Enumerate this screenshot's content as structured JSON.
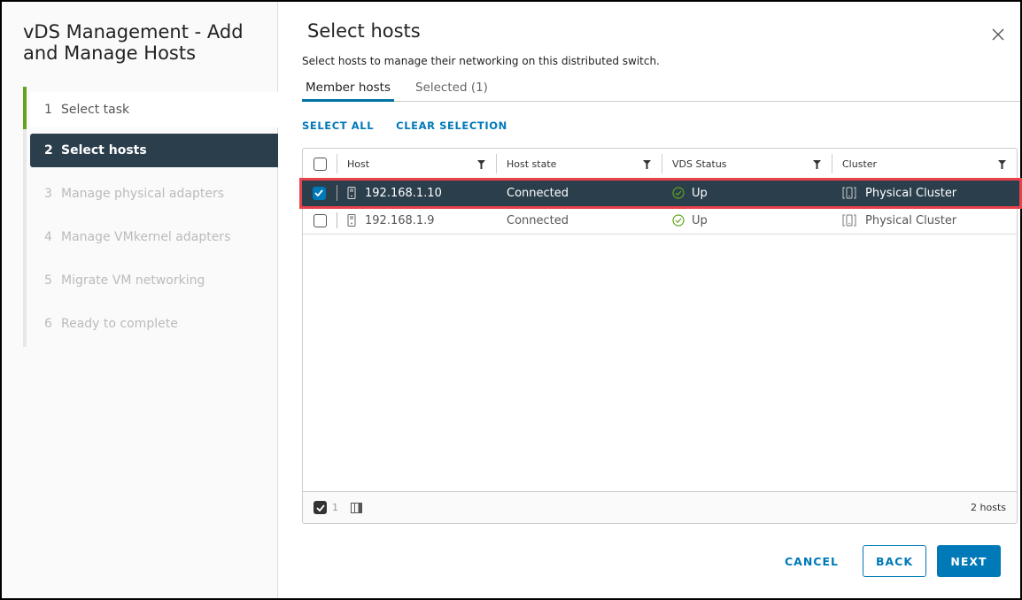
{
  "wizard": {
    "title": "vDS Management - Add and Manage Hosts",
    "steps": [
      {
        "num": "1",
        "label": "Select task",
        "state": "completed"
      },
      {
        "num": "2",
        "label": "Select hosts",
        "state": "active"
      },
      {
        "num": "3",
        "label": "Manage physical adapters",
        "state": "disabled"
      },
      {
        "num": "4",
        "label": "Manage VMkernel adapters",
        "state": "disabled"
      },
      {
        "num": "5",
        "label": "Migrate VM networking",
        "state": "disabled"
      },
      {
        "num": "6",
        "label": "Ready to complete",
        "state": "disabled"
      }
    ]
  },
  "page": {
    "title": "Select hosts",
    "subtitle": "Select hosts to manage their networking on this distributed switch.",
    "close_icon": "close-icon"
  },
  "tabs": [
    {
      "label": "Member hosts",
      "active": true
    },
    {
      "label": "Selected (1)",
      "active": false
    }
  ],
  "actions": {
    "select_all": "SELECT ALL",
    "clear_selection": "CLEAR SELECTION"
  },
  "grid": {
    "columns": [
      "Host",
      "Host state",
      "VDS Status",
      "Cluster"
    ],
    "rows": [
      {
        "host": "192.168.1.10",
        "state": "Connected",
        "vds_status": "Up",
        "cluster": "Physical Cluster",
        "selected": true
      },
      {
        "host": "192.168.1.9",
        "state": "Connected",
        "vds_status": "Up",
        "cluster": "Physical Cluster",
        "selected": false
      }
    ],
    "footer": {
      "selected_count": "1",
      "total": "2 hosts"
    }
  },
  "buttons": {
    "cancel": "CANCEL",
    "back": "BACK",
    "next": "NEXT"
  },
  "colors": {
    "accent": "#0079b8",
    "active_step": "#2b3e4c",
    "completed_step": "#62a420",
    "status_ok": "#62a420",
    "highlight_border": "#e8434a"
  }
}
